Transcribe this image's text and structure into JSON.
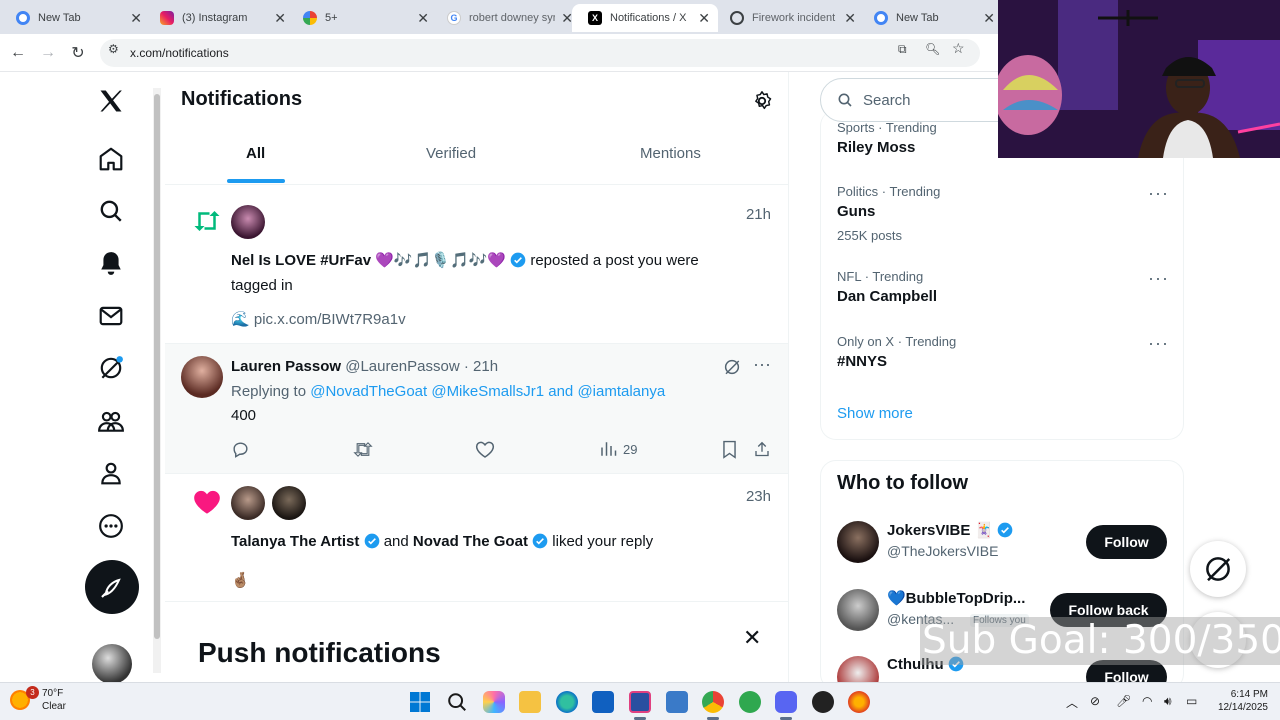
{
  "browser": {
    "tabs": [
      {
        "title": "New Tab",
        "active": false
      },
      {
        "title": "(3) Instagram",
        "active": false
      },
      {
        "title": "5+",
        "active": false
      },
      {
        "title": "robert downey syn",
        "active": false
      },
      {
        "title": "Notifications / X",
        "active": true
      },
      {
        "title": "Firework incident a",
        "active": false
      },
      {
        "title": "New Tab",
        "active": false
      }
    ],
    "url": "x.com/notifications"
  },
  "page": {
    "title": "Notifications",
    "tabs": [
      "All",
      "Verified",
      "Mentions"
    ],
    "active_tab": "All"
  },
  "notifications": {
    "repost": {
      "time": "21h",
      "user": "Nel Is LOVE #UrFav",
      "emoji": "💜🎶🎵🎙️🎵🎶💜",
      "action": "reposted a post you were tagged in",
      "media": "pic.x.com/BIWt7R9a1v"
    },
    "reply": {
      "name": "Lauren Passow",
      "handle": "@LaurenPassow",
      "time": "21h",
      "replying_prefix": "Replying to",
      "replying_to": "@NovadTheGoat @MikeSmallsJr1 and @iamtalanya",
      "text": "400",
      "views": "29"
    },
    "like": {
      "time": "23h",
      "user1": "Talanya The Artist",
      "conj": "and",
      "user2": "Novad The Goat",
      "action": "liked your reply",
      "emoji": "🤞🏽"
    }
  },
  "push_banner": {
    "title": "Push notifications"
  },
  "search": {
    "placeholder": "Search"
  },
  "trends": [
    {
      "meta": "Sports · Trending",
      "name": "Riley Moss",
      "count": ""
    },
    {
      "meta": "Politics · Trending",
      "name": "Guns",
      "count": "255K posts"
    },
    {
      "meta": "NFL · Trending",
      "name": "Dan Campbell",
      "count": ""
    },
    {
      "meta": "Only on X · Trending",
      "name": "#NNYS",
      "count": ""
    }
  ],
  "show_more": "Show more",
  "who_to_follow": {
    "title": "Who to follow",
    "accounts": [
      {
        "name": "JokersVIBE 🃏",
        "handle": "@TheJokersVIBE",
        "button": "Follow",
        "follows_you": ""
      },
      {
        "name": "💙BubbleTopDrip...",
        "handle": "@kentas...",
        "button": "Follow back",
        "follows_you": "Follows you"
      },
      {
        "name": "Cthulhu",
        "handle": "",
        "button": "Follow",
        "follows_you": ""
      }
    ]
  },
  "stream_overlay": {
    "sub_goal": "Sub Goal: 300/350"
  },
  "taskbar": {
    "temp": "70°F",
    "condition": "Clear",
    "weather_badge": "3",
    "time": "6:14 PM",
    "date": "12/14/2025"
  },
  "colors": {
    "accent": "#1d9bf0",
    "like": "#f91880",
    "repost": "#00ba7c"
  }
}
